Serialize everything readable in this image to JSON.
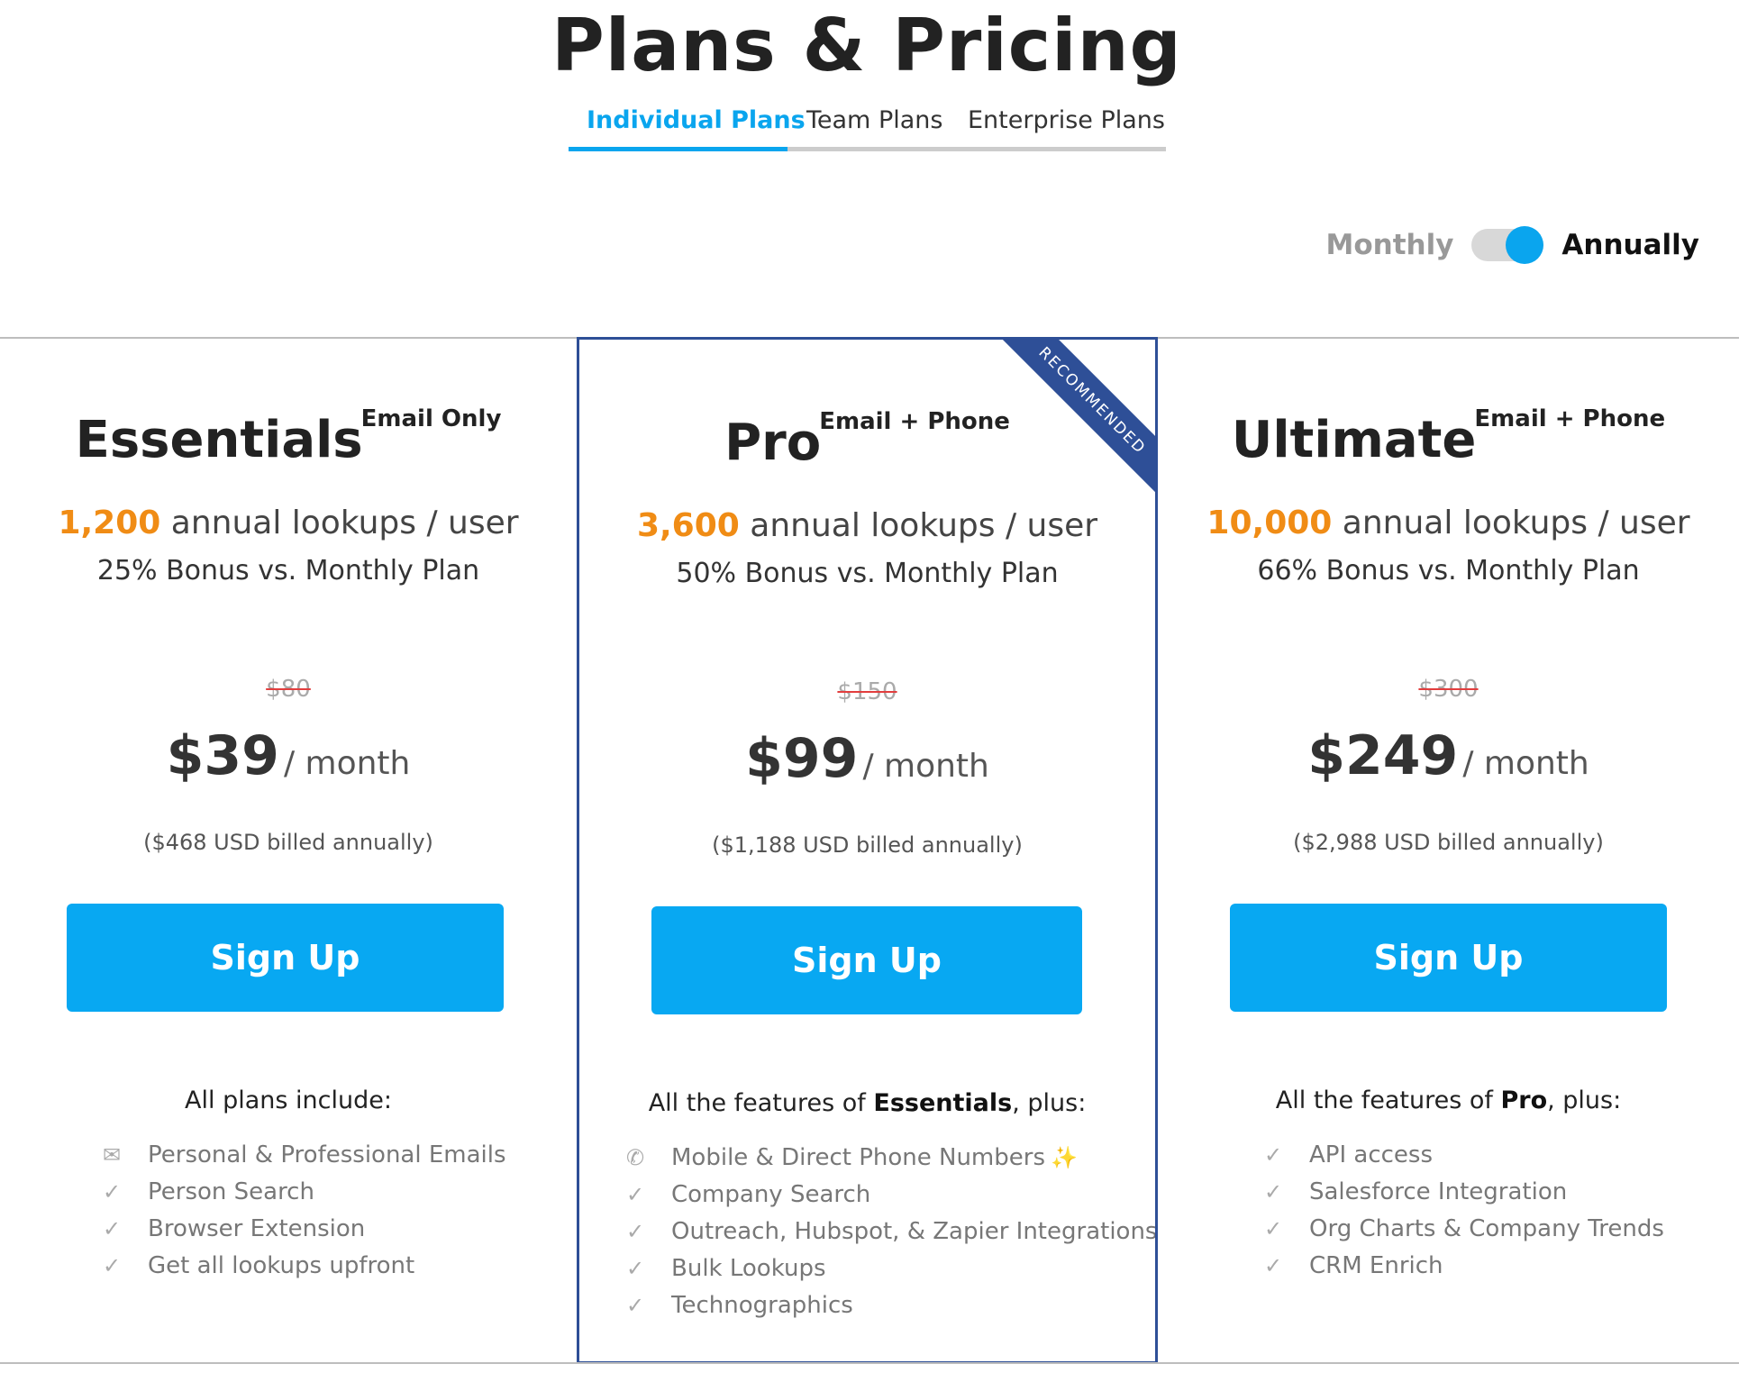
{
  "page": {
    "title": "Plans & Pricing"
  },
  "tabs": [
    {
      "label": "Individual Plans",
      "active": true
    },
    {
      "label": "Team Plans",
      "active": false
    },
    {
      "label": "Enterprise Plans",
      "active": false
    }
  ],
  "billing": {
    "monthly_label": "Monthly",
    "annually_label": "Annually",
    "selected": "Annually"
  },
  "colors": {
    "accent": "#0aa5ee",
    "button": "#08a8f2",
    "highlight_border": "#2e4f97",
    "orange": "#f08c15",
    "strike": "#e23e3e"
  },
  "plans": [
    {
      "name": "Essentials",
      "tag": "Email Only",
      "lookups_number": "1,200",
      "lookups_text": "annual lookups / user",
      "bonus": "25% Bonus vs. Monthly Plan",
      "old_price": "$80",
      "price": "$39",
      "per": "/ month",
      "billed": "($468 USD billed annually)",
      "cta": "Sign Up",
      "features_head": "All plans include:",
      "features": [
        {
          "icon": "envelope-icon",
          "text": "Personal & Professional Emails"
        },
        {
          "icon": "check-icon",
          "text": "Person Search"
        },
        {
          "icon": "check-icon",
          "text": "Browser Extension"
        },
        {
          "icon": "check-icon",
          "text": "Get all lookups upfront"
        }
      ]
    },
    {
      "name": "Pro",
      "tag": "Email + Phone",
      "ribbon": "RECOMMENDED",
      "lookups_number": "3,600",
      "lookups_text": "annual lookups / user",
      "bonus": "50% Bonus vs. Monthly Plan",
      "old_price": "$150",
      "price": "$99",
      "per": "/ month",
      "billed": "($1,188 USD billed annually)",
      "cta": "Sign Up",
      "features_head_pre": "All the features of ",
      "features_head_bold": "Essentials",
      "features_head_post": ", plus:",
      "features": [
        {
          "icon": "phone-icon",
          "text": "Mobile & Direct Phone Numbers",
          "extra_icon": "party-popper-icon"
        },
        {
          "icon": "check-icon",
          "text": "Company Search"
        },
        {
          "icon": "check-icon",
          "text": "Outreach, Hubspot, & Zapier Integrations"
        },
        {
          "icon": "check-icon",
          "text": "Bulk Lookups"
        },
        {
          "icon": "check-icon",
          "text": "Technographics"
        }
      ]
    },
    {
      "name": "Ultimate",
      "tag": "Email + Phone",
      "lookups_number": "10,000",
      "lookups_text": "annual lookups / user",
      "bonus": "66% Bonus vs. Monthly Plan",
      "old_price": "$300",
      "price": "$249",
      "per": "/ month",
      "billed": "($2,988 USD billed annually)",
      "cta": "Sign Up",
      "features_head_pre": "All the features of ",
      "features_head_bold": "Pro",
      "features_head_post": ", plus:",
      "features": [
        {
          "icon": "check-icon",
          "text": "API access"
        },
        {
          "icon": "check-icon",
          "text": "Salesforce Integration"
        },
        {
          "icon": "check-icon",
          "text": "Org Charts & Company Trends"
        },
        {
          "icon": "check-icon",
          "text": "CRM Enrich"
        }
      ]
    }
  ]
}
